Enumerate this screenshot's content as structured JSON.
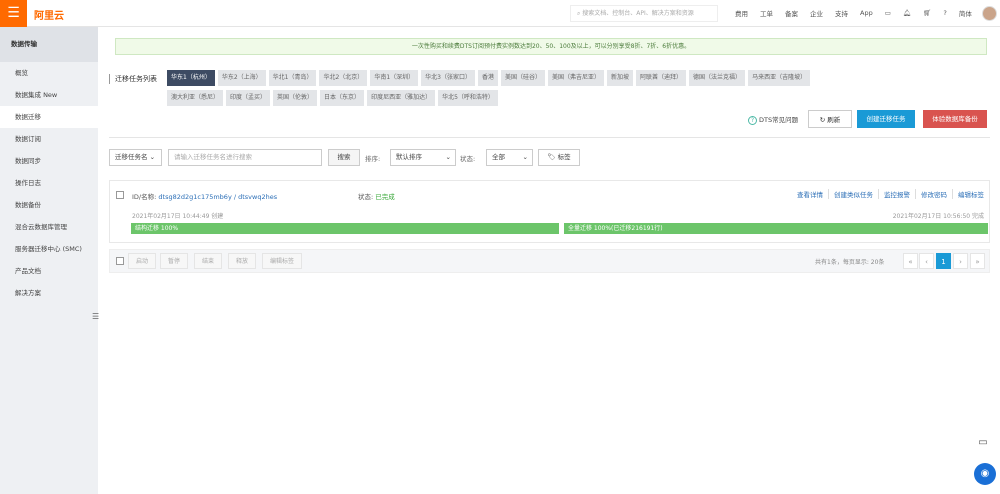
{
  "header": {
    "logo": "阿里云",
    "search_placeholder": "搜索文档、控制台、API、解决方案和资源",
    "nav": [
      "费用",
      "工单",
      "备案",
      "企业",
      "支持",
      "App"
    ],
    "lang": "简体"
  },
  "sidebar": {
    "title": "数据传输",
    "items": [
      "概览",
      "数据集成 New",
      "数据迁移",
      "数据订阅",
      "数据同步",
      "操作日志",
      "数据备份",
      "混合云数据库管理",
      "服务器迁移中心 (SMC)",
      "产品文档",
      "解决方案"
    ],
    "active": 2
  },
  "notice": "一次性购买和续费DTS订阅预付费实例数达到20、50、100及以上，可以分别享受8折、7折、6折优惠。",
  "regions": {
    "label": "迁移任务列表",
    "row1": [
      "华东1（杭州）",
      "华东2（上海）",
      "华北1（青岛）",
      "华北2（北京）",
      "华南1（深圳）",
      "华北3（张家口）",
      "香港",
      "美国（硅谷）",
      "美国（弗吉尼亚）",
      "新加坡",
      "阿联酋（迪拜）",
      "德国（法兰克福）",
      "马来西亚（吉隆坡）"
    ],
    "row2": [
      "澳大利亚（悉尼）",
      "印度（孟买）",
      "英国（伦敦）",
      "日本（东京）",
      "印度尼西亚（雅加达）",
      "华北5（呼和浩特）"
    ]
  },
  "actions": {
    "faq": "DTS常见问题",
    "refresh": "刷新",
    "create": "创建迁移任务",
    "buy": "体验数据库备份"
  },
  "filter": {
    "field": "迁移任务名",
    "placeholder": "请输入迁移任务名进行搜索",
    "search": "搜索",
    "sort_label": "排序:",
    "sort": "默认排序",
    "status_label": "状态:",
    "status": "全部",
    "tag": "标签"
  },
  "task": {
    "id_label": "ID/名称:",
    "id": "dtsg82d2g1c175mb6y / dtsvwq2hes",
    "status_label": "状态:",
    "status": "已完成",
    "ops": [
      "查看详情",
      "创建类似任务",
      "监控报警",
      "修改密码",
      "编辑标签"
    ],
    "created": "2021年02月17日 10:44:49  创建",
    "finished": "2021年02月17日 10:56:50  完成",
    "progress1": "结构迁移  100%",
    "progress2": "全量迁移  100%(已迁移216191行)",
    "progress1_value": 100,
    "progress2_value": 100
  },
  "footer": {
    "buttons": [
      "启动",
      "暂停",
      "结束",
      "释放",
      "编辑标签"
    ],
    "summary": "共有1条，每页显示: 20条",
    "pages": [
      "«",
      "‹",
      "1",
      "›",
      "»"
    ],
    "current": "1"
  }
}
